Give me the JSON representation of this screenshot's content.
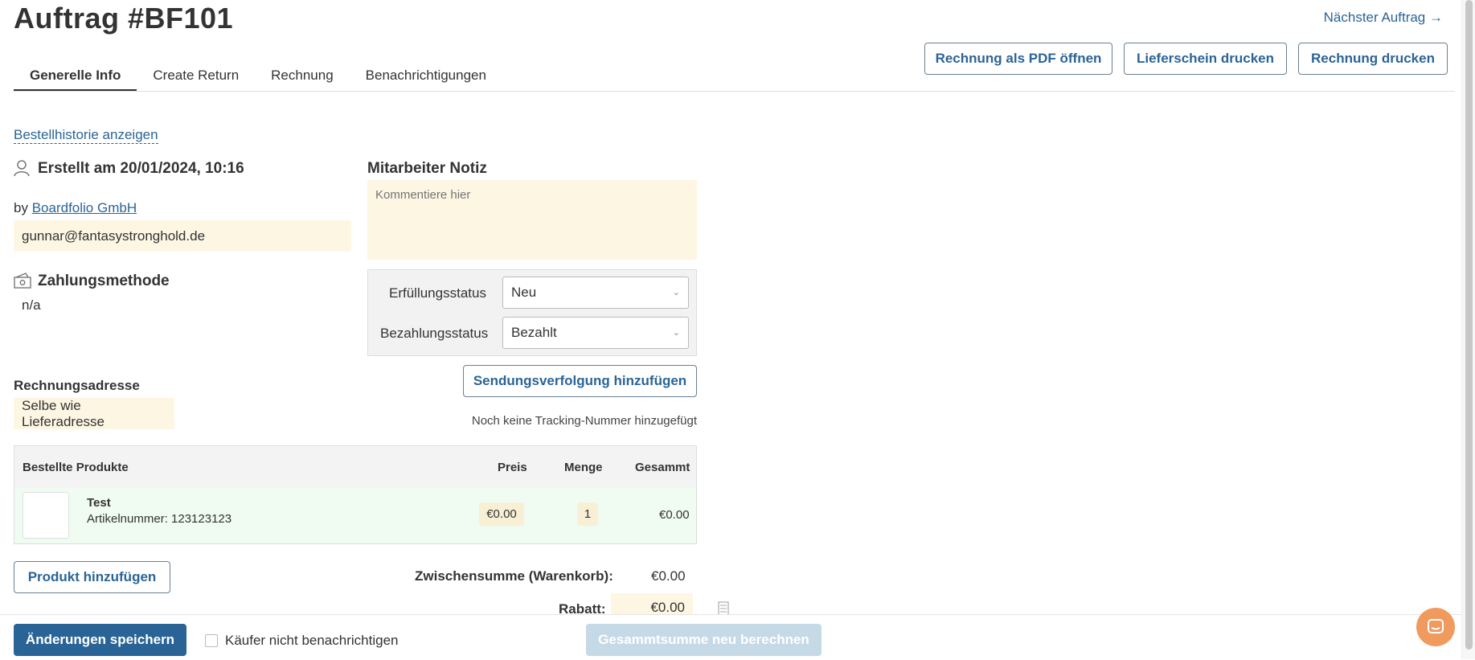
{
  "header": {
    "title": "Auftrag #BF101",
    "next_order": "Nächster Auftrag",
    "next_arrow": "→"
  },
  "tabs": [
    {
      "label": "Generelle Info",
      "active": true
    },
    {
      "label": "Create Return"
    },
    {
      "label": "Rechnung"
    },
    {
      "label": "Benachrichtigungen"
    }
  ],
  "actions": {
    "pdf": "Rechnung als PDF öffnen",
    "delivery_note": "Lieferschein drucken",
    "print_invoice": "Rechnung drucken"
  },
  "history_link": "Bestellhistorie anzeigen",
  "created": {
    "label": "Erstellt am 20/01/2024, 10:16",
    "by_prefix": "by",
    "company": "Boardfolio GmbH",
    "email": "gunnar@fantasystronghold.de"
  },
  "payment": {
    "heading": "Zahlungsmethode",
    "value": "n/a"
  },
  "billing": {
    "heading": "Rechnungsadresse",
    "value": "Selbe wie Lieferadresse"
  },
  "note": {
    "heading": "Mitarbeiter Notiz",
    "placeholder": "Kommentiere hier"
  },
  "status": {
    "fulfillment_label": "Erfüllungsstatus",
    "fulfillment_value": "Neu",
    "payment_label": "Bezahlungsstatus",
    "payment_value": "Bezahlt"
  },
  "tracking": {
    "button": "Sendungsverfolgung hinzufügen",
    "note": "Noch keine Tracking-Nummer hinzugefügt"
  },
  "products": {
    "headers": {
      "product": "Bestellte Produkte",
      "price": "Preis",
      "qty": "Menge",
      "total": "Gesammt"
    },
    "rows": [
      {
        "name": "Test",
        "sku_label": "Artikelnummer:",
        "sku": "123123123",
        "price": "€0.00",
        "qty": "1",
        "total": "€0.00"
      }
    ],
    "add_button": "Produkt hinzufügen"
  },
  "totals": {
    "subtotal_label": "Zwischensumme (Warenkorb):",
    "subtotal_value": "€0.00",
    "discount_label": "Rabatt:",
    "discount_value": "€0.00"
  },
  "footer": {
    "save": "Änderungen speichern",
    "no_notify": "Käufer nicht benachrichtigen",
    "recalc": "Gesammtsumme neu berechnen"
  },
  "colors": {
    "primary": "#2a6496",
    "note_bg": "#fdf6e3",
    "row_bg": "#f0fbf1",
    "chat": "#f09a5e"
  }
}
